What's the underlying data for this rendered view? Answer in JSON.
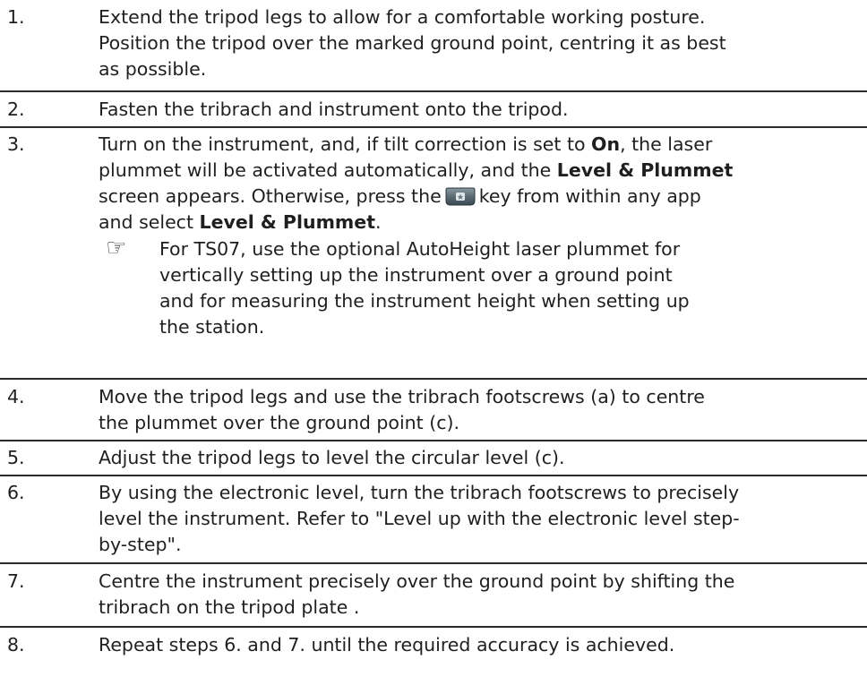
{
  "steps": [
    {
      "num": "1.",
      "lines": [
        "Extend the tripod legs to allow for a comfortable working posture.",
        "Position the tripod over the marked ground point, centring it as best",
        "as possible."
      ]
    },
    {
      "num": "2.",
      "lines": [
        "Fasten the tribrach and instrument onto the tripod."
      ]
    },
    {
      "num": "3.",
      "l1a": "Turn on the instrument, and, if tilt correction is set to ",
      "l1b": "On",
      "l1c": ", the laser",
      "l2a": "plummet will be activated automatically, and the ",
      "l2b": "Level & Plummet",
      "l3a": "screen appears. Otherwise, press the",
      "l3b": "key from within any app",
      "l4a": "and select ",
      "l4b": "Level & Plummet",
      "l4c": ".",
      "note_icon": "☞",
      "note_lines": [
        "For TS07, use the optional AutoHeight laser plummet for",
        "vertically setting up the instrument over a ground point",
        "and for measuring the instrument height when setting up",
        "the station."
      ]
    },
    {
      "num": "4.",
      "lines": [
        "Move the tripod legs and use the tribrach footscrews (a) to centre",
        "the plummet over the ground point (c)."
      ]
    },
    {
      "num": "5.",
      "lines": [
        "Adjust the tripod legs to level the circular level (c)."
      ]
    },
    {
      "num": "6.",
      "lines": [
        "By using the electronic level, turn the tribrach footscrews to precisely",
        "level the instrument. Refer to \"Level up with the electronic level step-",
        "by-step\"."
      ]
    },
    {
      "num": "7.",
      "lines": [
        "Centre the instrument precisely over the ground point by shifting the",
        "tribrach on the tripod plate ."
      ]
    },
    {
      "num": "8.",
      "lines": [
        "Repeat steps 6. and 7. until the required accuracy is achieved."
      ]
    }
  ],
  "icons": {
    "key": "favourites-key-icon",
    "note": "pointing-hand-icon"
  },
  "colors": {
    "rule": "#2a2a2a",
    "text": "#1f1f1f"
  }
}
